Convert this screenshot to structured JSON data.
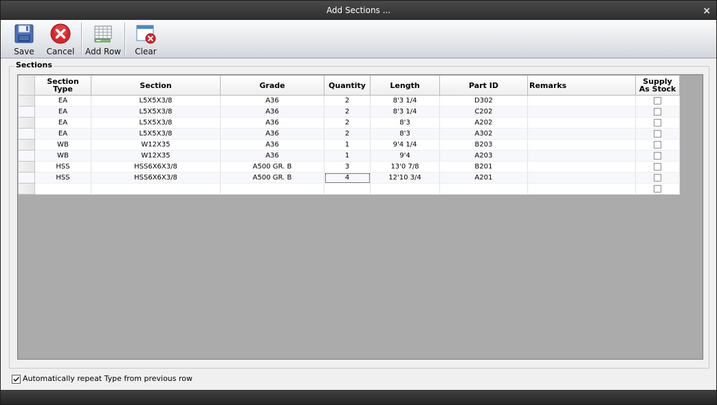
{
  "window": {
    "title": "Add Sections ...",
    "close_glyph": "×"
  },
  "toolbar": {
    "save_label": "Save",
    "cancel_label": "Cancel",
    "add_row_label": "Add Row",
    "clear_label": "Clear",
    "icons": {
      "save": "floppy-disk-icon",
      "cancel": "cancel-x-icon",
      "add_row": "grid-add-icon",
      "clear": "clear-window-icon"
    },
    "colors": {
      "cancel_red": "#d8262a",
      "save_blue": "#4a6fb5"
    }
  },
  "sections": {
    "group_label": "Sections",
    "columns": [
      "Section Type",
      "Section",
      "Grade",
      "Quantity",
      "Length",
      "Part ID",
      "Remarks",
      "Supply As Stock"
    ],
    "rows": [
      [
        "EA",
        "L5X5X3/8",
        "A36",
        "2",
        "8'3 1/4",
        "D302",
        ""
      ],
      [
        "EA",
        "L5X5X3/8",
        "A36",
        "2",
        "8'3 1/4",
        "C202",
        ""
      ],
      [
        "EA",
        "L5X5X3/8",
        "A36",
        "2",
        "8'3",
        "A202",
        ""
      ],
      [
        "EA",
        "L5X5X3/8",
        "A36",
        "2",
        "8'3",
        "A302",
        ""
      ],
      [
        "WB",
        "W12X35",
        "A36",
        "1",
        "9'4 1/4",
        "B203",
        ""
      ],
      [
        "WB",
        "W12X35",
        "A36",
        "1",
        "9'4",
        "A203",
        ""
      ],
      [
        "HSS",
        "HSS6X6X3/8",
        "A500 GR. B",
        "3",
        "13'0 7/8",
        "B201",
        ""
      ],
      [
        "HSS",
        "HSS6X6X3/8",
        "A500 GR. B",
        "4",
        "12'10 3/4",
        "A201",
        ""
      ],
      [
        "",
        "",
        "",
        "",
        "",
        "",
        ""
      ]
    ],
    "supply_as_stock": [
      false,
      false,
      false,
      false,
      false,
      false,
      false,
      false,
      false
    ],
    "focused_cell": {
      "row": 7,
      "column": "Quantity"
    }
  },
  "footer": {
    "auto_repeat_label": "Automatically repeat Type from previous row",
    "auto_repeat_checked": true
  }
}
